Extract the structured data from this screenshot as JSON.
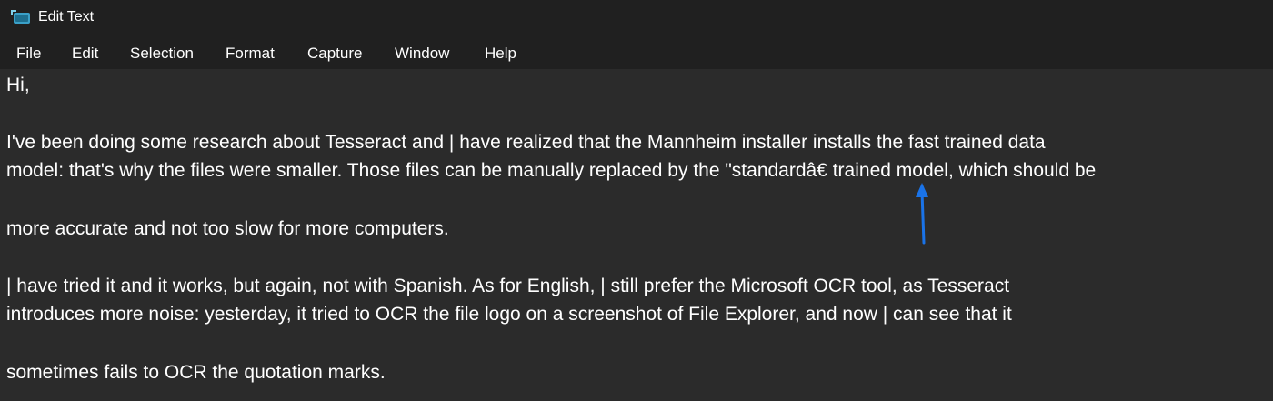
{
  "window": {
    "title": "Edit Text",
    "icon": "app-window-icon"
  },
  "menu": {
    "file": "File",
    "edit": "Edit",
    "selection": "Selection",
    "format": "Format",
    "capture": "Capture",
    "window": "Window",
    "help": "Help"
  },
  "editor": {
    "lines": [
      "Hi,",
      "I've been doing some research about Tesseract and | have realized that the Mannheim installer installs the fast trained data",
      "model: that's why the files were smaller. Those files can be manually replaced by the \"standardâ€ trained model, which should be",
      "more accurate and not too slow for more computers.",
      "| have tried it and it works, but again, not with Spanish. As for English, | still prefer the Microsoft OCR tool, as Tesseract",
      "introduces more noise: yesterday, it tried to OCR the file logo on a screenshot of File Explorer, and now | can see that it",
      "sometimes fails to OCR the quotation marks."
    ]
  },
  "annotation": {
    "arrow_color": "#1a73e8",
    "icon": "arrow-up-icon"
  }
}
